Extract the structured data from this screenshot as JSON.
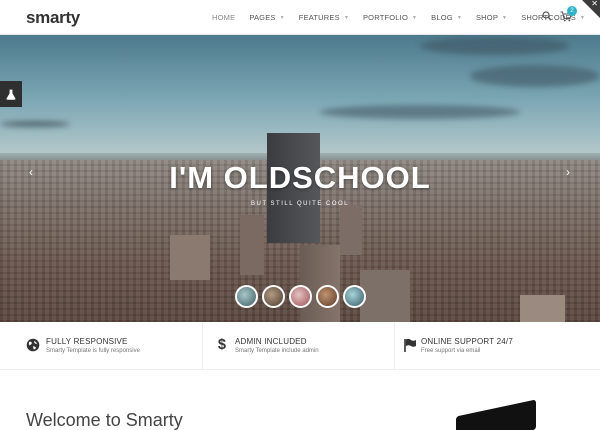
{
  "header": {
    "logo": "smarty",
    "nav": [
      {
        "label": "HOME",
        "active": true
      },
      {
        "label": "PAGES",
        "active": false
      },
      {
        "label": "FEATURES",
        "active": false
      },
      {
        "label": "PORTFOLIO",
        "active": false
      },
      {
        "label": "BLOG",
        "active": false
      },
      {
        "label": "SHOP",
        "active": false
      },
      {
        "label": "SHORTCODES",
        "active": false
      }
    ],
    "cart_count": "2",
    "search_icon": "search-icon",
    "cart_icon": "cart-icon"
  },
  "hero": {
    "title": "I'M OLDSCHOOL",
    "subtitle": "BUT STILL QUITE COOL",
    "thumbnails": 5
  },
  "features": [
    {
      "icon": "globe-icon",
      "title": "FULLY RESPONSIVE",
      "desc": "Smarty Template is fully responsive"
    },
    {
      "icon": "dollar-icon",
      "title": "ADMIN INCLUDED",
      "desc": "Smarty Template include admin"
    },
    {
      "icon": "flag-icon",
      "title": "ONLINE SUPPORT 24/7",
      "desc": "Free support via email"
    }
  ],
  "welcome": {
    "title": "Welcome to Smarty"
  },
  "colors": {
    "accent": "#2bb5c8",
    "dark": "#333333"
  }
}
